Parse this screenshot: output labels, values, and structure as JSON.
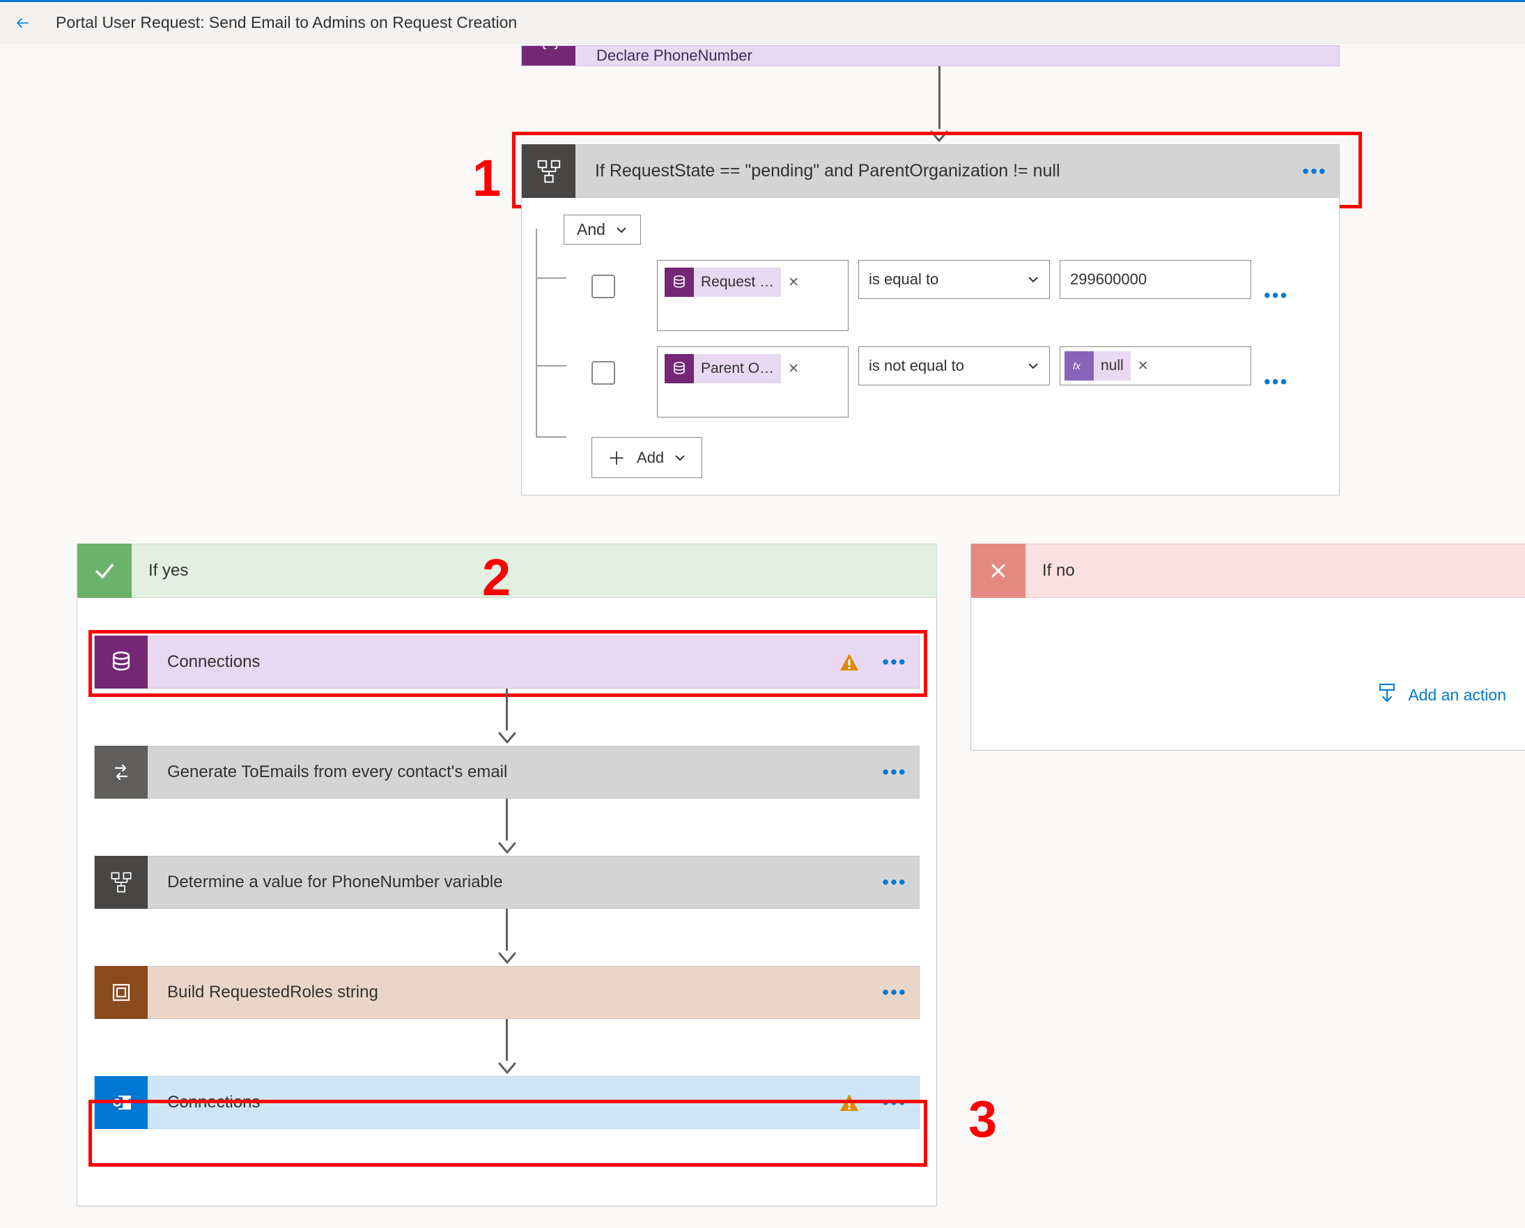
{
  "header": {
    "title": "Portal User Request: Send Email to Admins on Request Creation"
  },
  "topStep": {
    "label": "Declare PhoneNumber"
  },
  "annotations": {
    "a1": "1",
    "a2": "2",
    "a3": "3"
  },
  "condition": {
    "title": "If RequestState == \"pending\" and ParentOrganization != null",
    "logicOp": "And",
    "addLabel": "Add",
    "rows": [
      {
        "lhs_label": "Request …",
        "operator": "is equal to",
        "rhs_type": "text",
        "rhs_text": "299600000"
      },
      {
        "lhs_label": "Parent O…",
        "operator": "is not equal to",
        "rhs_type": "fx",
        "rhs_text": "null"
      }
    ]
  },
  "yes": {
    "title": "If yes",
    "steps": [
      {
        "kind": "dataverse",
        "label": "Connections",
        "warn": true
      },
      {
        "kind": "loop",
        "label": "Generate ToEmails from every contact's email",
        "warn": false
      },
      {
        "kind": "condition",
        "label": "Determine a value for PhoneNumber variable",
        "warn": false
      },
      {
        "kind": "compose",
        "label": "Build RequestedRoles string",
        "warn": false
      },
      {
        "kind": "outlook",
        "label": "Connections",
        "warn": true
      }
    ]
  },
  "no": {
    "title": "If no",
    "addActionLabel": "Add an action"
  }
}
